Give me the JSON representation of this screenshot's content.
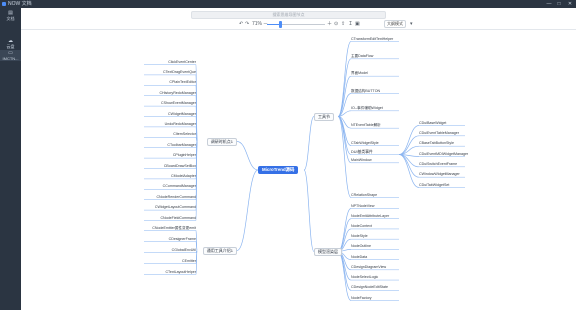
{
  "app": {
    "title": "NOW 文档",
    "minimize": "—",
    "maximize": "□",
    "close": "✕"
  },
  "sidebar": {
    "items": [
      {
        "label": "文档",
        "icon": "document-icon"
      },
      {
        "label": "云盘",
        "icon": "cloud-icon"
      },
      {
        "label": "IMCTN...",
        "icon": "file-icon"
      }
    ]
  },
  "toolbar": {
    "search_placeholder": "搜索思维导图节点",
    "undo": "↶",
    "redo": "↷",
    "zoom": "71%",
    "zoom_out": "－",
    "zoom_in": "＋",
    "fit": "⊙",
    "view_label": "大纲模式",
    "more": "▾"
  },
  "colors": {
    "accent": "#3570e6",
    "sidebar_bg": "#2b3542",
    "line": "#8ab4f0"
  },
  "mindmap": {
    "root": "MicroTrend源码",
    "left_branches": [
      {
        "label": "调研时机点1",
        "children": [
          "ClickEventCenter",
          "CTextDragEventQue",
          "CPlainTextEditor",
          "CHistoryRedoManager",
          "CShowEventManager",
          "CWidgetManager",
          "UndoRedoManager",
          "CItemSelector",
          "CToolbarManager",
          "CPluginHelper",
          "CBoardDrawSetBox",
          "CModelAdapter",
          "CCommandManager",
          "CNodeRenderCommand",
          "CWidgetLayoutCommand",
          "CNodeFieldCommand"
        ]
      },
      {
        "label": "通用工具介绍1",
        "children": [
          "CNodeEmitter属性变更emit",
          "CDesignerFrame",
          "CGlobalEnvUtil",
          "CEmitter",
          "CTextLayoutHelper"
        ]
      }
    ],
    "right_branches": [
      {
        "label": "工具节",
        "children": [
          {
            "label": "CTransformEditTextHelper",
            "children": []
          },
          {
            "label": "主要DataFlow",
            "children": []
          },
          {
            "label": "界面Model",
            "children": []
          },
          {
            "label": "数据结构BUTTON",
            "children": []
          },
          {
            "label": "IO--事件辅助Widget",
            "children": []
          },
          {
            "label": "NTEventTable解析",
            "children": []
          },
          {
            "label": "CTabWidgetStyle",
            "children": []
          },
          {
            "label": "MainWindow",
            "children": []
          },
          {
            "label": "DUI基类事件",
            "children": [
              "CDuiBaseWidget",
              "CDuiEventTableManager",
              "CBaseTabButtonStyle",
              "CDuiEventMDIWidgetManager",
              "CDuiSwitchEventFrame",
              "CWindowWidgetManager",
              "CDuiTabWidgetSet"
            ]
          },
          {
            "label": "CRelationShape",
            "children": []
          }
        ]
      },
      {
        "label": "模型渲染层",
        "children": [
          {
            "label": "NPTNodeView",
            "children": []
          },
          {
            "label": "NodeEmitAttributeLayer",
            "children": []
          },
          {
            "label": "NodeContext",
            "children": []
          },
          {
            "label": "NodeStyle",
            "children": []
          },
          {
            "label": "NodeOutline",
            "children": []
          },
          {
            "label": "NodeData",
            "children": []
          },
          {
            "label": "CDesignDiagramView",
            "children": []
          },
          {
            "label": "NodeSelectLogic",
            "children": []
          },
          {
            "label": "CDesignNodeEditState",
            "children": []
          },
          {
            "label": "NodeFactory",
            "children": []
          }
        ]
      }
    ]
  }
}
